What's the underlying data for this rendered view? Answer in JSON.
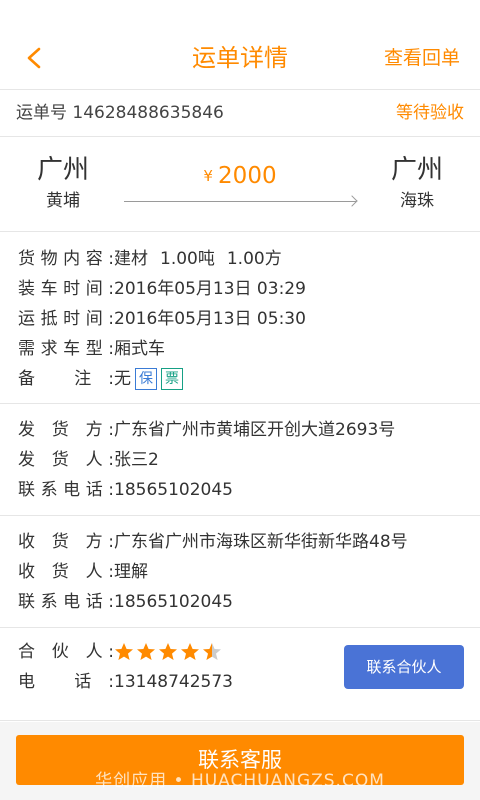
{
  "nav": {
    "title": "运单详情",
    "right": "查看回单"
  },
  "order": {
    "label": "运单号",
    "number": "14628488635846",
    "status": "等待验收"
  },
  "route": {
    "from": {
      "city": "广州",
      "district": "黄埔"
    },
    "to": {
      "city": "广州",
      "district": "海珠"
    },
    "currency": "¥",
    "price": "2000"
  },
  "cargo": {
    "content_label": "货物内容:",
    "content_type": "建材",
    "weight": "1.00吨",
    "volume": "1.00方",
    "load_label": "装车时间:",
    "load_time": "2016年05月13日 03:29",
    "arrive_label": "运抵时间:",
    "arrive_time": "2016年05月13日 05:30",
    "vehicle_label": "需求车型:",
    "vehicle": "厢式车",
    "remark_label": "备 注:",
    "remark": "无",
    "tag_bao": "保",
    "tag_piao": "票"
  },
  "shipper": {
    "addr_label": "发 货 方:",
    "address": "广东省广州市黄埔区开创大道2693号",
    "person_label": "发 货 人:",
    "person": "张三2",
    "phone_label": "联系电话:",
    "phone": "18565102045"
  },
  "receiver": {
    "addr_label": "收 货 方:",
    "address": "广东省广州市海珠区新华街新华路48号",
    "person_label": "收 货 人:",
    "person": "理解",
    "phone_label": "联系电话:",
    "phone": "18565102045"
  },
  "partner": {
    "label": "合 伙 人:",
    "rating": 4.5,
    "rating_max": 5,
    "phone_label": "电 话:",
    "phone": "13148742573",
    "button": "联系合伙人"
  },
  "footer": {
    "button": "联系客服",
    "watermark": "华创应用 • HUACHUANGZS.COM"
  },
  "colors": {
    "accent": "#ff8a00",
    "partner_button": "#4a73d6",
    "tag_bao": "#3a7bd5",
    "tag_piao": "#16a085"
  }
}
